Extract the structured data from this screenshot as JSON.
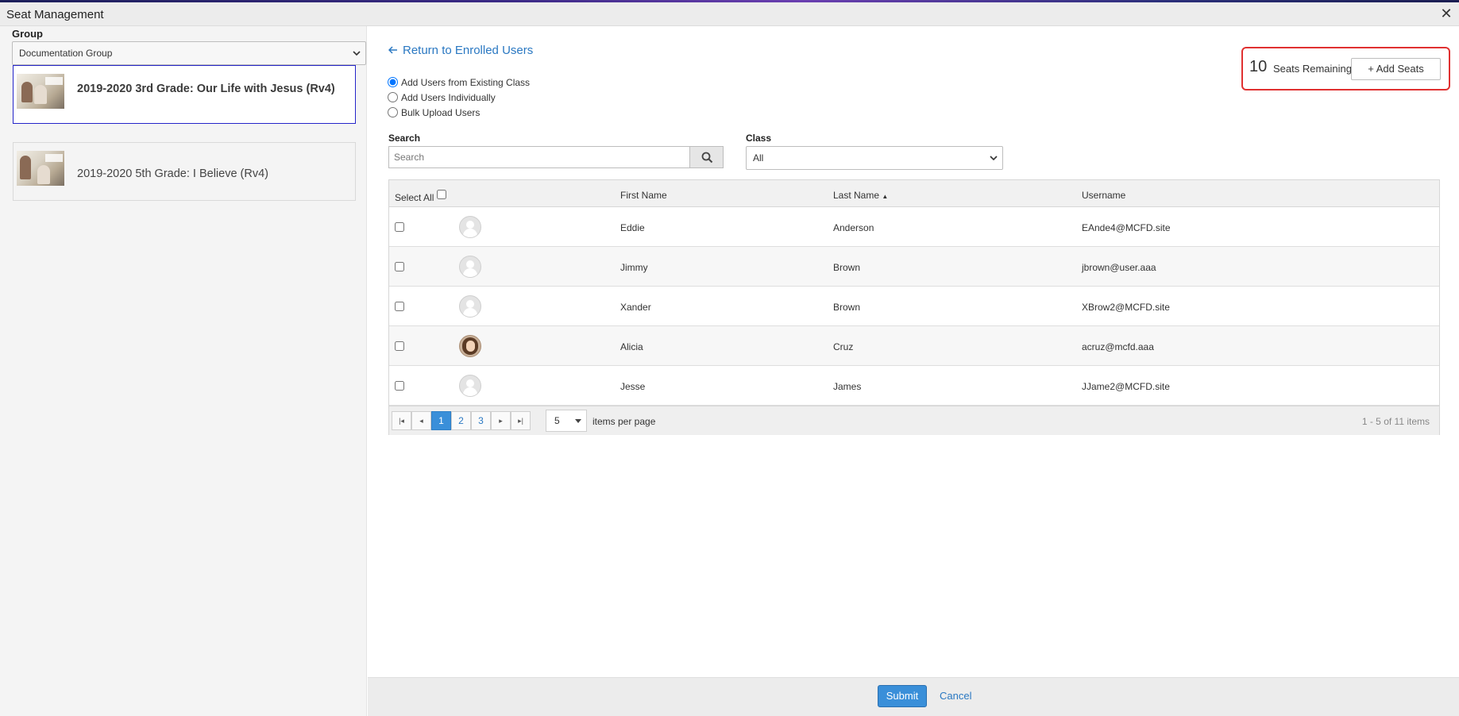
{
  "window": {
    "title": "Seat Management",
    "close_glyph": "✕"
  },
  "sidebar": {
    "group_label": "Group",
    "group_value": "Documentation Group",
    "courses": [
      {
        "title": "2019-2020 3rd Grade: Our Life with Jesus (Rv4)",
        "selected": true
      },
      {
        "title": "2019-2020 5th Grade: I Believe (Rv4)",
        "selected": false
      }
    ]
  },
  "main": {
    "return_link": "Return to Enrolled Users",
    "options": [
      {
        "label": "Add Users from Existing Class",
        "checked": true
      },
      {
        "label": "Add Users Individually",
        "checked": false
      },
      {
        "label": "Bulk Upload Users",
        "checked": false
      }
    ],
    "seats": {
      "count": "10",
      "label": "Seats Remaining",
      "add_button": "+ Add Seats"
    },
    "search": {
      "label": "Search",
      "placeholder": "Search"
    },
    "class_filter": {
      "label": "Class",
      "value": "All"
    },
    "grid": {
      "columns": {
        "select_all": "Select All",
        "first_name": "First Name",
        "last_name": "Last Name",
        "username": "Username"
      },
      "sort_indicator": "▲",
      "rows": [
        {
          "first": "Eddie",
          "last": "Anderson",
          "username": "EAnde4@MCFD.site",
          "avatar": "placeholder"
        },
        {
          "first": "Jimmy",
          "last": "Brown",
          "username": "jbrown@user.aaa",
          "avatar": "placeholder"
        },
        {
          "first": "Xander",
          "last": "Brown",
          "username": "XBrow2@MCFD.site",
          "avatar": "placeholder"
        },
        {
          "first": "Alicia",
          "last": "Cruz",
          "username": "acruz@mcfd.aaa",
          "avatar": "photo"
        },
        {
          "first": "Jesse",
          "last": "James",
          "username": "JJame2@MCFD.site",
          "avatar": "placeholder"
        }
      ]
    },
    "pager": {
      "first": "|◂",
      "prev": "◂",
      "next": "▸",
      "last": "▸|",
      "pages": [
        "1",
        "2",
        "3"
      ],
      "current_page": "1",
      "items_per_page_value": "5",
      "items_per_page_label": "items per page",
      "info": "1 - 5 of 11 items"
    }
  },
  "footer": {
    "submit": "Submit",
    "cancel": "Cancel"
  },
  "colors": {
    "accent": "#3a8fd9",
    "link": "#2a78c2",
    "highlight_border": "#e03131",
    "selected_card_border": "#2525c9"
  }
}
